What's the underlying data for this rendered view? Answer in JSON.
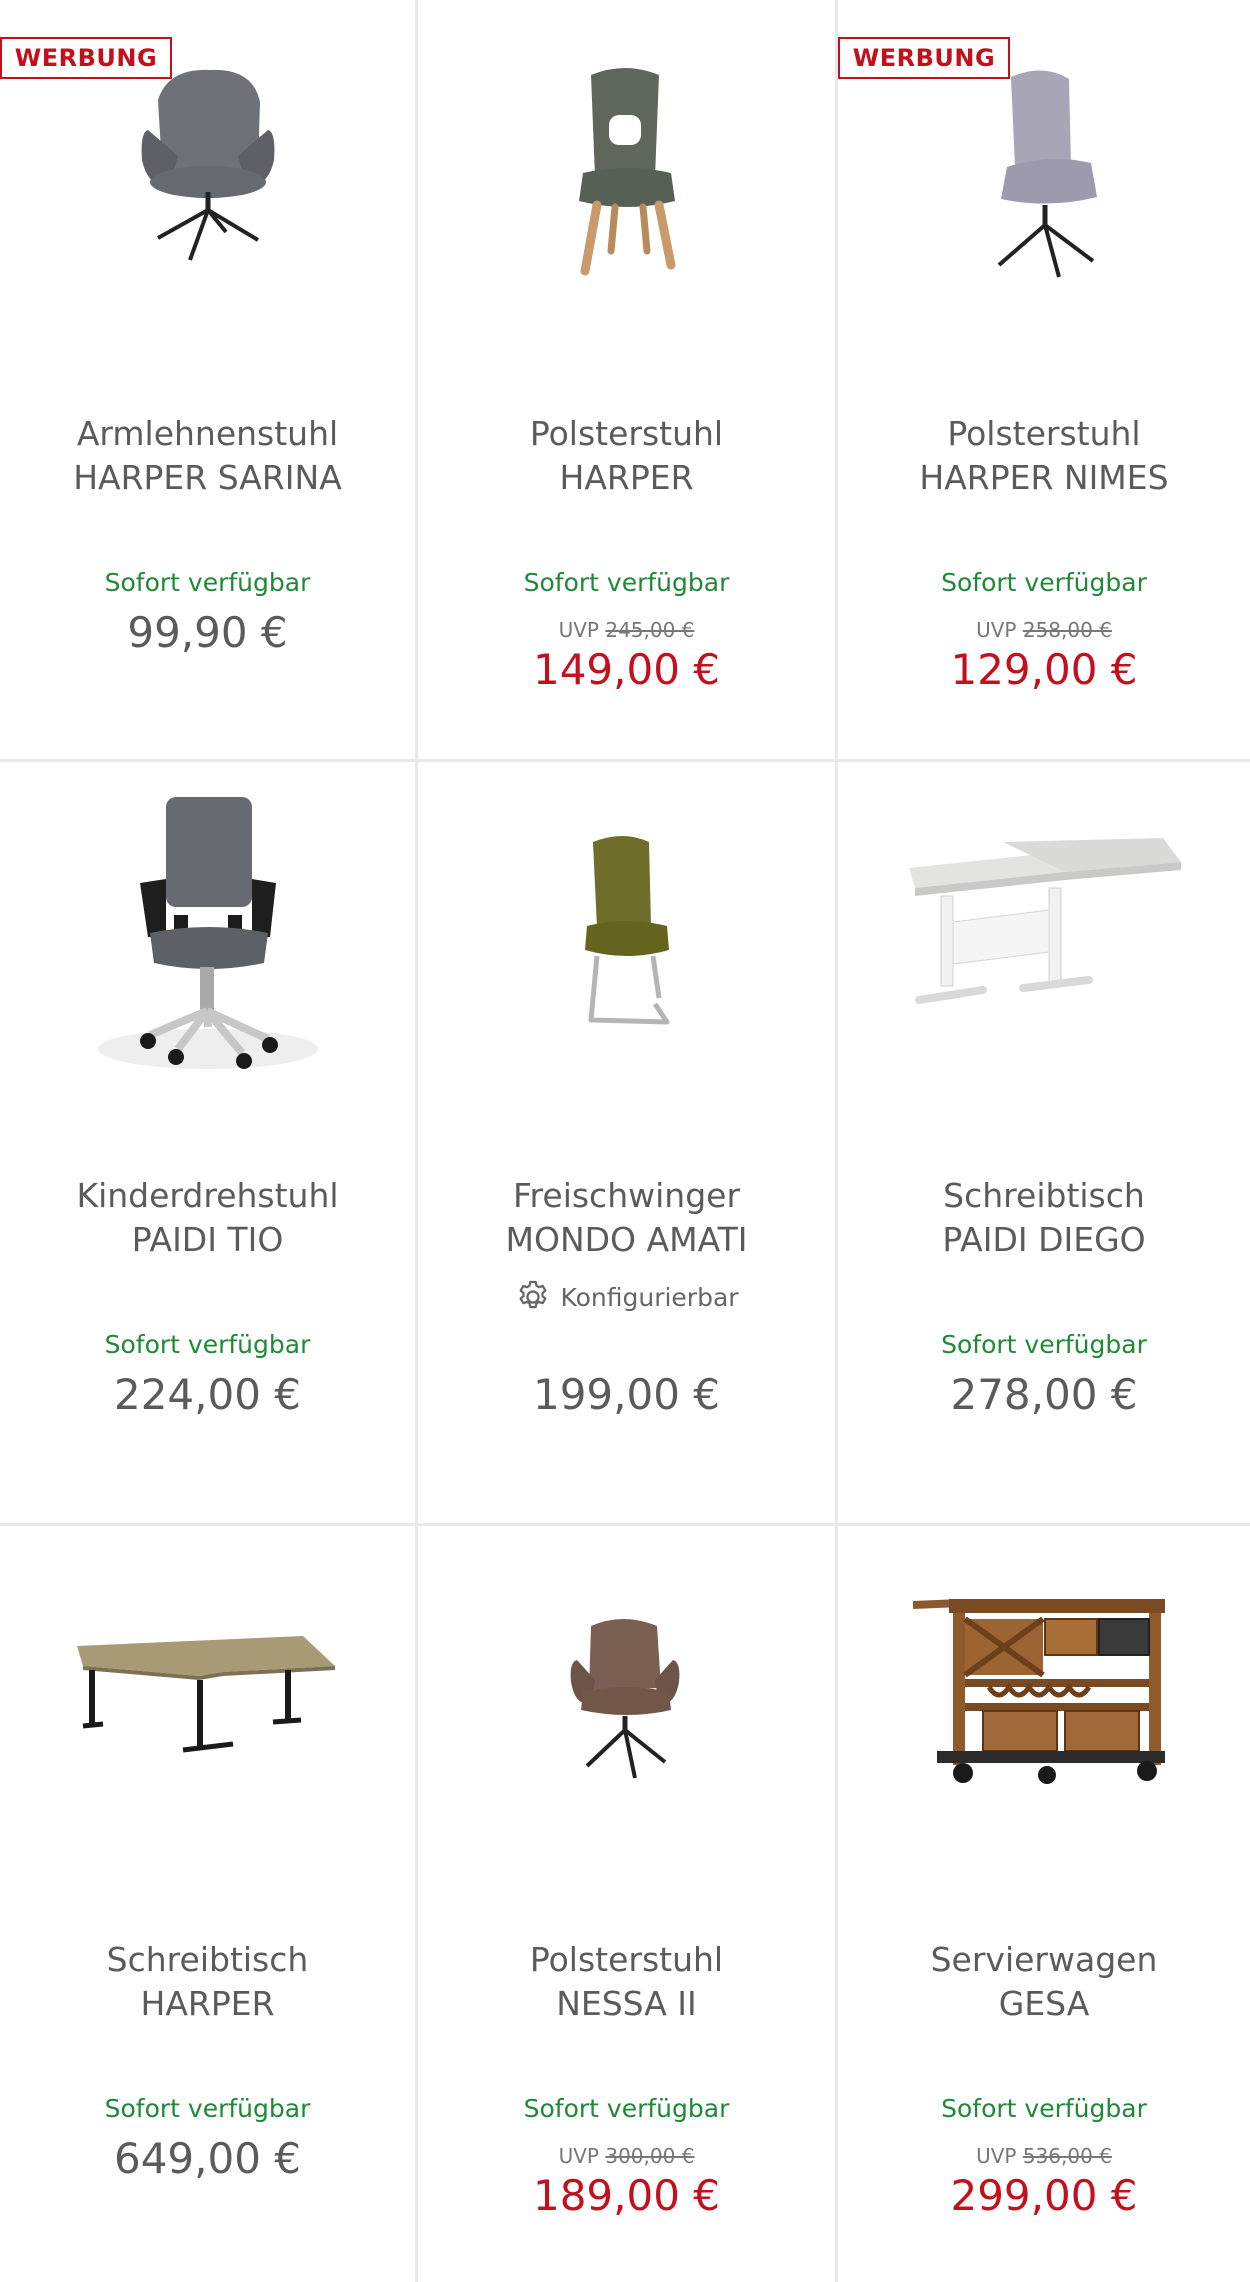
{
  "badge_label": "WERBUNG",
  "colors": {
    "badge": "#c4101c",
    "available": "#1e8a38",
    "sale_price": "#c4101c",
    "text": "#5b5b5b",
    "divider": "#e9e9e9"
  },
  "products": [
    {
      "type": "Armlehnenstuhl",
      "model": "HARPER SARINA",
      "badge": true,
      "availability": "Sofort verfügbar",
      "price": "99,90 €",
      "sale": false,
      "image": "armchair-grey-icon"
    },
    {
      "type": "Polsterstuhl",
      "model": "HARPER",
      "badge": false,
      "availability": "Sofort verfügbar",
      "uvp_label": "UVP",
      "uvp_price": "245,00 €",
      "price": "149,00 €",
      "sale": true,
      "image": "chair-olive-wood-icon"
    },
    {
      "type": "Polsterstuhl",
      "model": "HARPER NIMES",
      "badge": true,
      "availability": "Sofort verfügbar",
      "uvp_label": "UVP",
      "uvp_price": "258,00 €",
      "price": "129,00 €",
      "sale": true,
      "image": "chair-lilac-icon"
    },
    {
      "type": "Kinderdrehstuhl",
      "model": "PAIDI TIO",
      "badge": false,
      "availability": "Sofort verfügbar",
      "price": "224,00 €",
      "sale": false,
      "image": "office-chair-icon"
    },
    {
      "type": "Freischwinger",
      "model": "MONDO AMATI",
      "badge": false,
      "config_label": "Konfigurierbar",
      "price": "199,00 €",
      "sale": false,
      "image": "cantilever-chair-icon"
    },
    {
      "type": "Schreibtisch",
      "model": "PAIDI DIEGO",
      "badge": false,
      "availability": "Sofort verfügbar",
      "price": "278,00 €",
      "sale": false,
      "image": "kids-desk-icon"
    },
    {
      "type": "Schreibtisch",
      "model": "HARPER",
      "badge": false,
      "availability": "Sofort verfügbar",
      "price": "649,00 €",
      "sale": false,
      "image": "corner-desk-icon"
    },
    {
      "type": "Polsterstuhl",
      "model": "NESSA II",
      "badge": false,
      "availability": "Sofort verfügbar",
      "uvp_label": "UVP",
      "uvp_price": "300,00 €",
      "price": "189,00 €",
      "sale": true,
      "image": "chair-brown-icon"
    },
    {
      "type": "Servierwagen",
      "model": "GESA",
      "badge": false,
      "availability": "Sofort verfügbar",
      "uvp_label": "UVP",
      "uvp_price": "536,00 €",
      "price": "299,00 €",
      "sale": true,
      "image": "serving-cart-icon"
    }
  ]
}
